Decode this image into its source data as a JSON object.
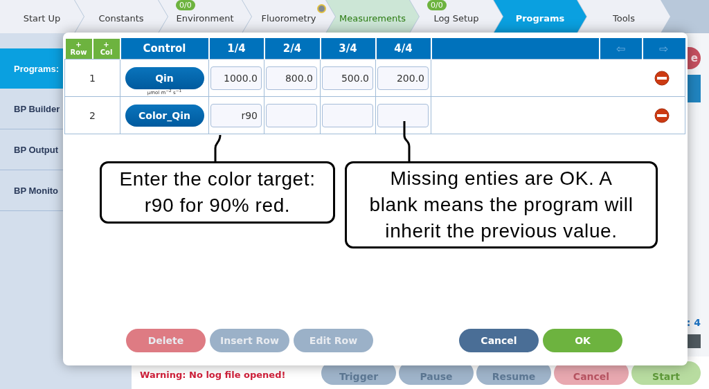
{
  "nav": [
    {
      "label": "Start Up",
      "selected": false,
      "done": false,
      "dot": false
    },
    {
      "label": "Constants",
      "selected": false,
      "done": false,
      "dot": false
    },
    {
      "label": "Environment",
      "selected": false,
      "done": false,
      "badge": "0/0",
      "dot": false
    },
    {
      "label": "Fluorometry",
      "selected": false,
      "done": false,
      "dot": true
    },
    {
      "label": "Measurements",
      "selected": false,
      "done": true,
      "dot": false
    },
    {
      "label": "Log Setup",
      "selected": false,
      "done": false,
      "badge": "0/0",
      "dot": false
    },
    {
      "label": "Programs",
      "selected": true,
      "done": false,
      "dot": false
    },
    {
      "label": "Tools",
      "selected": false,
      "done": false,
      "dot": false
    }
  ],
  "sidebar": {
    "items": [
      {
        "label": "Programs:",
        "selected": true
      },
      {
        "label": "BP Builder",
        "selected": false
      },
      {
        "label": "BP Output",
        "selected": false
      },
      {
        "label": "BP Monito",
        "selected": false
      }
    ]
  },
  "background": {
    "side_button": "e",
    "counter": ": 4",
    "warning": "Warning: No log file opened!",
    "buttons": [
      {
        "label": "Trigger",
        "kind": "neutral"
      },
      {
        "label": "Pause",
        "kind": "neutral"
      },
      {
        "label": "Resume",
        "kind": "neutral"
      },
      {
        "label": "Cancel",
        "kind": "danger"
      },
      {
        "label": "Start",
        "kind": "go"
      }
    ]
  },
  "dialog": {
    "add_buttons": [
      {
        "sign": "+",
        "label": "Row"
      },
      {
        "sign": "+",
        "label": "Col"
      }
    ],
    "header": {
      "control": "Control",
      "steps": [
        "1/4",
        "2/4",
        "3/4",
        "4/4"
      ],
      "arrows": [
        "⇦",
        "⇨"
      ]
    },
    "rows": [
      {
        "number": "1",
        "control": "Qin",
        "unit": "μmol m$^{−2}$ s$^{−1}$",
        "steps": [
          {
            "value": "1000.0"
          },
          {
            "value": "800.0"
          },
          {
            "value": "500.0"
          },
          {
            "value": "200.0"
          }
        ]
      },
      {
        "number": "2",
        "control": "Color_Qin",
        "steps": [
          {
            "value": "r90"
          }
        ]
      }
    ],
    "callouts": [
      {
        "lines": [
          "Enter the color target:",
          "r90 for 90% red."
        ]
      },
      {
        "lines": [
          "Missing enties are OK. A",
          "blank means the program will",
          "inherit the previous value."
        ]
      }
    ],
    "buttons": [
      {
        "label": "Delete",
        "kind": "danger",
        "disabled": true
      },
      {
        "label": "Insert Row",
        "kind": "neutral",
        "disabled": true
      },
      {
        "label": "Edit Row",
        "kind": "neutral",
        "disabled": true
      },
      {
        "label": "Cancel",
        "kind": "primary",
        "disabled": false
      },
      {
        "label": "OK",
        "kind": "go",
        "disabled": false
      }
    ]
  }
}
